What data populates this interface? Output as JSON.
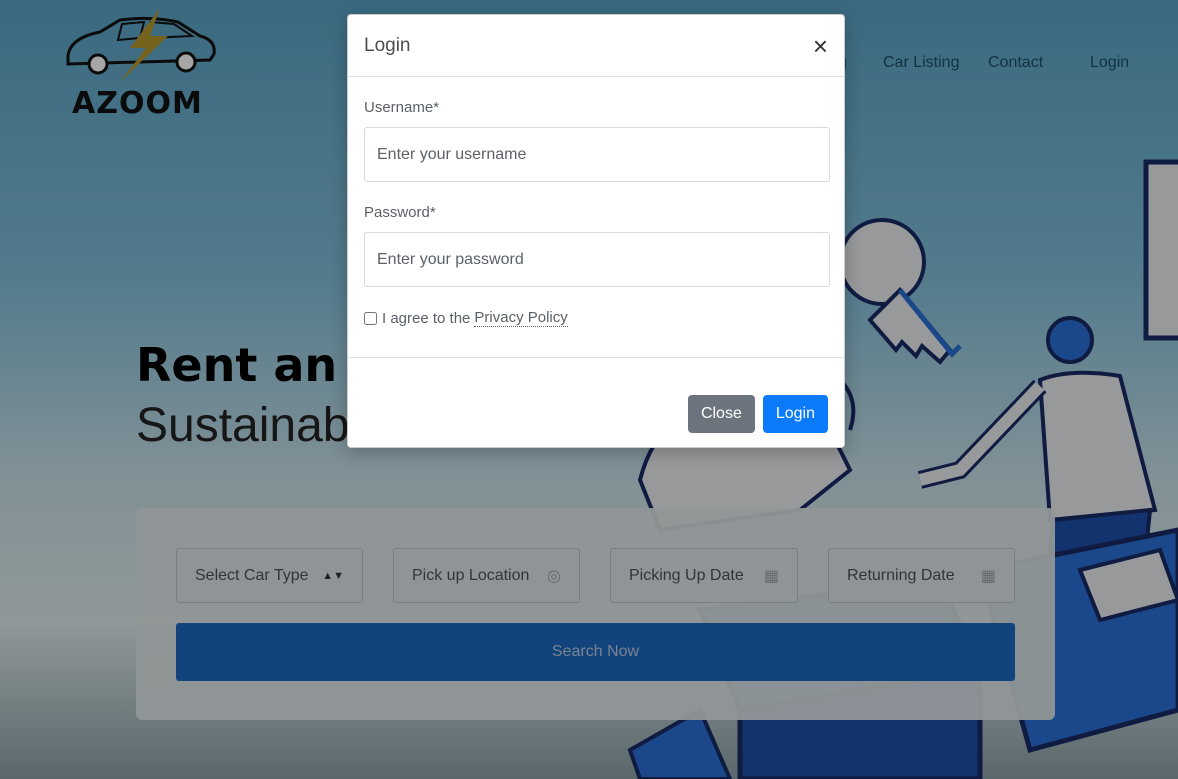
{
  "brand": {
    "name": "AZOOM"
  },
  "nav": {
    "items": [
      {
        "label": "g"
      },
      {
        "label": "Car Listing"
      },
      {
        "label": "Contact"
      },
      {
        "label": "Login"
      }
    ]
  },
  "hero": {
    "title": "Rent an I",
    "subtitle": "Sustainabl"
  },
  "search": {
    "car_type": "Select Car Type",
    "pickup_location": "Pick up Location",
    "pickup_date": "Picking Up Date",
    "return_date": "Returning Date",
    "button_label": "Search Now"
  },
  "modal": {
    "title": "Login",
    "close_symbol": "×",
    "username_label": "Username*",
    "username_placeholder": "Enter your username",
    "password_label": "Password*",
    "password_placeholder": "Enter your password",
    "agree_text": "I agree to the",
    "policy_link": "Privacy Policy",
    "close_button": "Close",
    "login_button": "Login"
  },
  "colors": {
    "primary": "#0b7bfb",
    "secondary": "#6c757d",
    "search_button": "#1d67c0"
  }
}
